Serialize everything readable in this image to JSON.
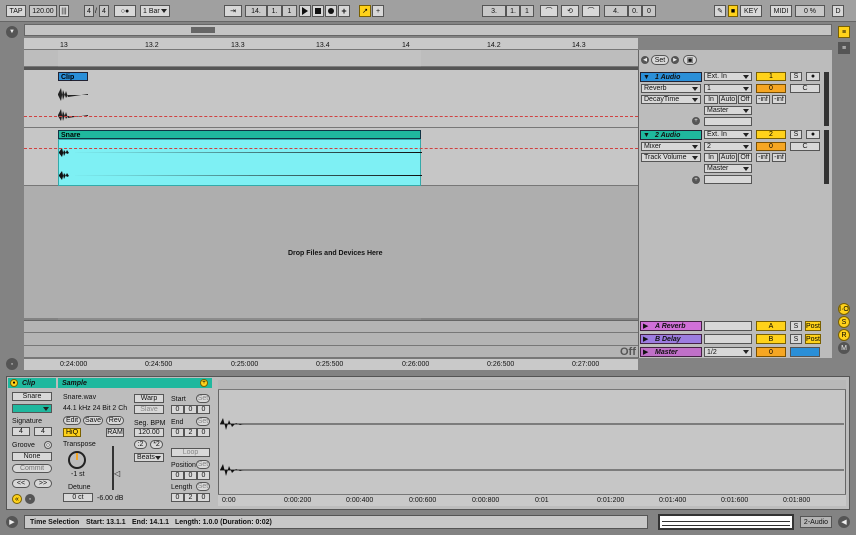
{
  "transport": {
    "tap": "TAP",
    "tempo": "120.00",
    "signature_num": "4",
    "signature_den": "4",
    "metronome": "○●",
    "quantize": "1 Bar",
    "position": [
      "14.",
      "1.",
      "1"
    ],
    "loop_start": [
      "3.",
      "1.",
      "1"
    ],
    "loop_length": [
      "4.",
      "0.",
      "0"
    ],
    "key": "KEY",
    "midi": "MIDI",
    "cpu": "0 %",
    "disk": "D"
  },
  "ruler": {
    "bars": [
      "13",
      "13.2",
      "13.3",
      "13.4",
      "14",
      "14.2",
      "14.3"
    ],
    "times": [
      "0:24:000",
      "0:24:500",
      "0:25:000",
      "0:25:500",
      "0:26:000",
      "0:26:500",
      "0:27:000"
    ]
  },
  "set_button": "Set",
  "drop_text": "Drop Files and Devices Here",
  "off_label": "Off",
  "tracks": [
    {
      "name": "1 Audio",
      "clip_name": "Clip",
      "color": "#2a8fd8",
      "input_type": "Ext. In",
      "input_channel": "1",
      "monitor": [
        "In",
        "Auto",
        "Off"
      ],
      "output": "Master",
      "device": "Reverb",
      "param": "DecayTime",
      "number": "1",
      "volume": "0",
      "pan": "C",
      "sends": [
        "-inf",
        "-inf"
      ],
      "solo": "S"
    },
    {
      "name": "2 Audio",
      "clip_name": "Snare",
      "color": "#1fb89e",
      "input_type": "Ext. In",
      "input_channel": "2",
      "monitor": [
        "In",
        "Auto",
        "Off"
      ],
      "output": "Master",
      "device": "Mixer",
      "param": "Track Volume",
      "number": "2",
      "volume": "0",
      "pan": "C",
      "sends": [
        "-inf",
        "-inf"
      ],
      "solo": "S"
    }
  ],
  "returns": [
    {
      "name": "A Reverb",
      "letter": "A",
      "solo": "S",
      "post": "Post",
      "color": "#d070d8"
    },
    {
      "name": "B Delay",
      "letter": "B",
      "solo": "S",
      "post": "Post",
      "color": "#9c7ce0"
    }
  ],
  "master": {
    "name": "Master",
    "cue": "1/2",
    "volume": "0",
    "color": "#c070c8"
  },
  "clip_view": {
    "clip_label": "Clip",
    "clip_name": "Snare",
    "signature_label": "Signature",
    "sig_num": "4",
    "sig_den": "4",
    "groove_label": "Groove",
    "groove_value": "None",
    "commit": "Commit",
    "nudge_left": "<<",
    "nudge_right": ">>",
    "sample_label": "Sample",
    "sample_file": "Snare.wav",
    "sample_info": "44.1 kHz 24 Bit 2 Ch",
    "edit": "Edit",
    "save": "Save",
    "rev": "Rev",
    "hiq": "HiQ",
    "ram": "RAM",
    "transpose_label": "Transpose",
    "transpose_value": "-1 st",
    "detune_label": "Detune",
    "detune_value": "0 ct",
    "gain_value": "-6.00 dB",
    "warp": "Warp",
    "slave": "Slave",
    "seg_bpm_label": "Seg. BPM",
    "seg_bpm": "120.00",
    "half": ":2",
    "double": "*2",
    "warp_mode": "Beats",
    "start_label": "Start",
    "start_value": [
      "0",
      "0",
      "0"
    ],
    "end_label": "End",
    "end_value": [
      "0",
      "2",
      "0"
    ],
    "loop": "Loop",
    "position_label": "Position",
    "position_value": [
      "0",
      "0",
      "0"
    ],
    "length_label": "Length",
    "length_value": [
      "0",
      "2",
      "0"
    ],
    "set": "Set"
  },
  "sample_ruler": [
    "0:00",
    "0:00:200",
    "0:00:400",
    "0:00:600",
    "0:00:800",
    "0:01",
    "0:01:200",
    "0:01:400",
    "0:01:600",
    "0:01:800"
  ],
  "status": {
    "text": "Time Selection",
    "start": "Start: 13.1.1",
    "end": "End: 14.1.1",
    "length": "Length: 1.0.0 (Duration: 0:02)",
    "track": "2-Audio"
  }
}
